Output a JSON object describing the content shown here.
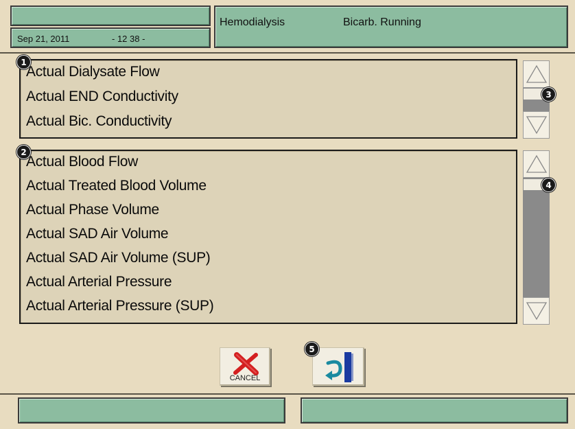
{
  "header": {
    "date": "Sep 21, 2011",
    "time": "- 12 38 -",
    "mode": "Hemodialysis",
    "status": "Bicarb. Running"
  },
  "panel1": {
    "badge": "1",
    "items": [
      "Actual Dialysate Flow",
      "Actual END Conductivity",
      "Actual Bic. Conductivity"
    ]
  },
  "panel2": {
    "badge": "2",
    "items": [
      "Actual Blood Flow",
      "Actual Treated Blood Volume",
      "Actual Phase Volume",
      "Actual SAD Air Volume",
      "Actual SAD Air Volume (SUP)",
      "Actual Arterial Pressure",
      "Actual Arterial Pressure (SUP)"
    ]
  },
  "scrollbars": {
    "badge1": "3",
    "badge2": "4",
    "up_icon": "triangle-up-icon",
    "down_icon": "triangle-down-icon"
  },
  "actions": {
    "cancel_label": "CANCEL",
    "back_badge": "5",
    "cancel_icon": "red-x-icon",
    "back_icon": "return-arrow-icon"
  },
  "colors": {
    "background": "#e8dcc0",
    "header_green": "#8cbca0",
    "panel_bg": "#ddd3b8",
    "scroll_track": "#8a8a8a",
    "cancel_red": "#d42020",
    "back_teal": "#1a8aa0",
    "back_blue": "#1a3aa0"
  }
}
